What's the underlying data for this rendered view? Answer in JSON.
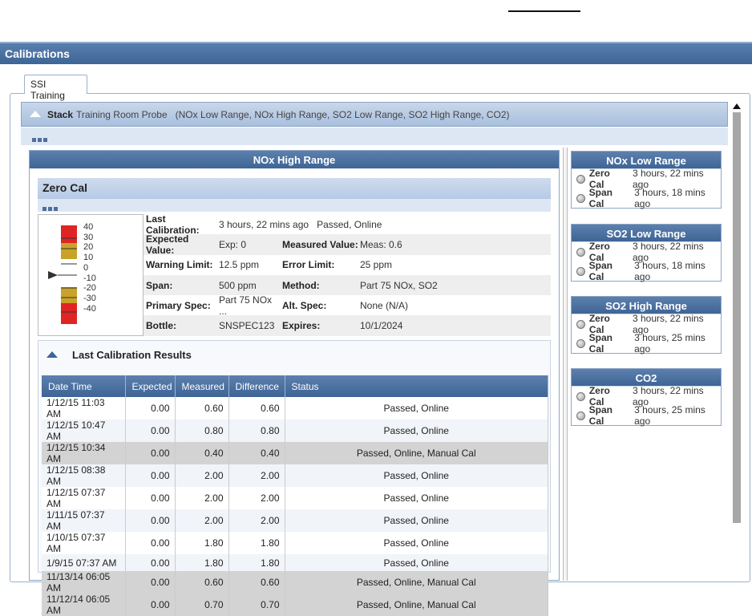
{
  "app": {
    "title": "Calibrations"
  },
  "tabs": [
    {
      "label": "SSI Training",
      "active": true
    }
  ],
  "stack": {
    "label": "Stack",
    "description": "Training Room Probe   (NOx Low Range, NOx High Range, SO2 Low Range, SO2 High Range, CO2)"
  },
  "main_panel": {
    "title": "NOx High Range",
    "section_title": "Zero Cal",
    "gauge_ticks": [
      "40",
      "30",
      "20",
      "10",
      "0",
      "-10",
      "-20",
      "-30",
      "-40"
    ],
    "gauge_value": 0,
    "info": {
      "last_calibration_label": "Last Calibration:",
      "last_calibration_value": "3 hours, 22 mins ago   Passed, Online",
      "expected_label": "Expected Value:",
      "expected_value": "Exp: 0",
      "measured_label": "Measured Value:",
      "measured_value": "Meas: 0.6",
      "warning_label": "Warning Limit:",
      "warning_value": "12.5 ppm",
      "error_label": "Error Limit:",
      "error_value": "25 ppm",
      "span_label": "Span:",
      "span_value": "500 ppm",
      "method_label": "Method:",
      "method_value": "Part 75 NOx, SO2",
      "primary_label": "Primary Spec:",
      "primary_value": "Part 75 NOx ...",
      "alt_label": "Alt. Spec:",
      "alt_value": "None (N/A)",
      "bottle_label": "Bottle:",
      "bottle_value": "SNSPEC123",
      "expires_label": "Expires:",
      "expires_value": "10/1/2024"
    },
    "results": {
      "title": "Last Calibration Results",
      "columns": [
        "Date Time",
        "Expected",
        "Measured",
        "Difference",
        "Status"
      ],
      "rows": [
        [
          "1/12/15 11:03 AM",
          "0.00",
          "0.60",
          "0.60",
          "Passed, Online"
        ],
        [
          "1/12/15 10:47 AM",
          "0.00",
          "0.80",
          "0.80",
          "Passed, Online"
        ],
        [
          "1/12/15 10:34 AM",
          "0.00",
          "0.40",
          "0.40",
          "Passed, Online, Manual Cal"
        ],
        [
          "1/12/15 08:38 AM",
          "0.00",
          "2.00",
          "2.00",
          "Passed, Online"
        ],
        [
          "1/12/15 07:37 AM",
          "0.00",
          "2.00",
          "2.00",
          "Passed, Online"
        ],
        [
          "1/11/15 07:37 AM",
          "0.00",
          "2.00",
          "2.00",
          "Passed, Online"
        ],
        [
          "1/10/15 07:37 AM",
          "0.00",
          "1.80",
          "1.80",
          "Passed, Online"
        ],
        [
          "1/9/15 07:37 AM",
          "0.00",
          "1.80",
          "1.80",
          "Passed, Online"
        ],
        [
          "11/13/14 06:05 AM",
          "0.00",
          "0.60",
          "0.60",
          "Passed, Online, Manual Cal"
        ],
        [
          "11/12/14 06:05 AM",
          "0.00",
          "0.70",
          "0.70",
          "Passed, Online, Manual Cal"
        ]
      ]
    }
  },
  "side_panels": [
    {
      "title": "NOx Low Range",
      "rows": [
        {
          "label": "Zero Cal",
          "time": "3 hours, 22 mins ago"
        },
        {
          "label": "Span Cal",
          "time": "3 hours, 18 mins ago"
        }
      ]
    },
    {
      "title": "SO2 Low Range",
      "rows": [
        {
          "label": "Zero Cal",
          "time": "3 hours, 22 mins ago"
        },
        {
          "label": "Span Cal",
          "time": "3 hours, 18 mins ago"
        }
      ]
    },
    {
      "title": "SO2 High Range",
      "rows": [
        {
          "label": "Zero Cal",
          "time": "3 hours, 22 mins ago"
        },
        {
          "label": "Span Cal",
          "time": "3 hours, 25 mins ago"
        }
      ]
    },
    {
      "title": "CO2",
      "rows": [
        {
          "label": "Zero Cal",
          "time": "3 hours, 22 mins ago"
        },
        {
          "label": "Span Cal",
          "time": "3 hours, 25 mins ago"
        }
      ]
    }
  ]
}
